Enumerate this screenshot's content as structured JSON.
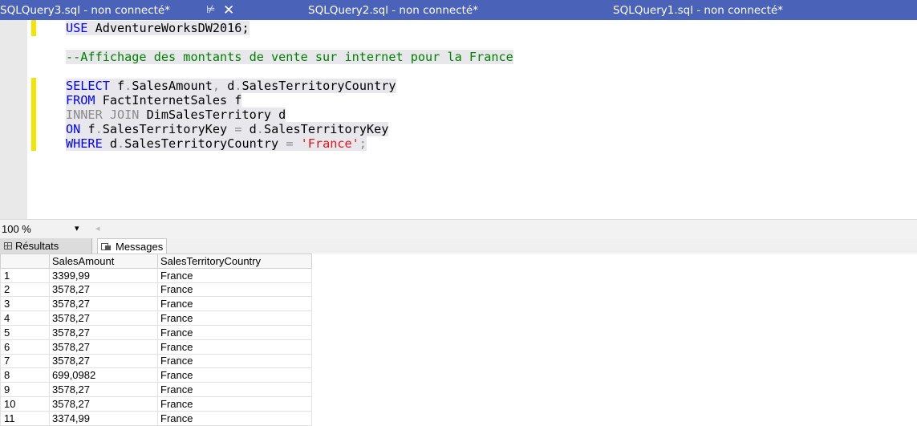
{
  "tabs": [
    {
      "label": "SQLQuery3.sql - non connecté*"
    },
    {
      "label": "SQLQuery2.sql - non connecté*"
    },
    {
      "label": "SQLQuery1.sql - non connecté*"
    }
  ],
  "tab_icons": {
    "pin": "pin-icon",
    "close": "close-icon"
  },
  "editor": {
    "lines": [
      {
        "use_kw": "USE",
        "use_db": " AdventureWorksDW2016;"
      },
      {
        "comment": "--Affichage des montants de vente sur internet pour la France"
      },
      {
        "kw": "SELECT",
        "text_a": " f",
        "dot": ".",
        "text_b": "SalesAmount",
        "comma": ",",
        "text_c": " d",
        "dot2": ".",
        "text_d": "SalesTerritoryCountry"
      },
      {
        "kw": "FROM",
        "text": " FactInternetSales f"
      },
      {
        "kw": "INNER JOIN",
        "text": " DimSalesTerritory d"
      },
      {
        "kw": "ON",
        "text_a": " f",
        "dot": ".",
        "text_b": "SalesTerritoryKey",
        "eq": " = ",
        "text_c": "d",
        "dot2": ".",
        "text_d": "SalesTerritoryKey"
      },
      {
        "kw": "WHERE",
        "text_a": " d",
        "dot": ".",
        "text_b": "SalesTerritoryCountry",
        "eq": " = ",
        "str": "'France'",
        "semi": ";"
      }
    ]
  },
  "zoom": {
    "value": "100 %",
    "arrow": "▾",
    "scroll_left": "◂"
  },
  "result_tabs": {
    "results": "Résultats",
    "messages": "Messages"
  },
  "grid": {
    "columns": [
      "",
      "SalesAmount",
      "SalesTerritoryCountry"
    ],
    "rows": [
      [
        "1",
        "3399,99",
        "France"
      ],
      [
        "2",
        "3578,27",
        "France"
      ],
      [
        "3",
        "3578,27",
        "France"
      ],
      [
        "4",
        "3578,27",
        "France"
      ],
      [
        "5",
        "3578,27",
        "France"
      ],
      [
        "6",
        "3578,27",
        "France"
      ],
      [
        "7",
        "3578,27",
        "France"
      ],
      [
        "8",
        "699,0982",
        "France"
      ],
      [
        "9",
        "3578,27",
        "France"
      ],
      [
        "10",
        "3578,27",
        "France"
      ],
      [
        "11",
        "3374,99",
        "France"
      ]
    ]
  },
  "colors": {
    "tabbar": "#4a63b8",
    "keyword": "#0000ff",
    "comment": "#008000",
    "string": "#e0141e",
    "changebar": "#f2e500"
  }
}
